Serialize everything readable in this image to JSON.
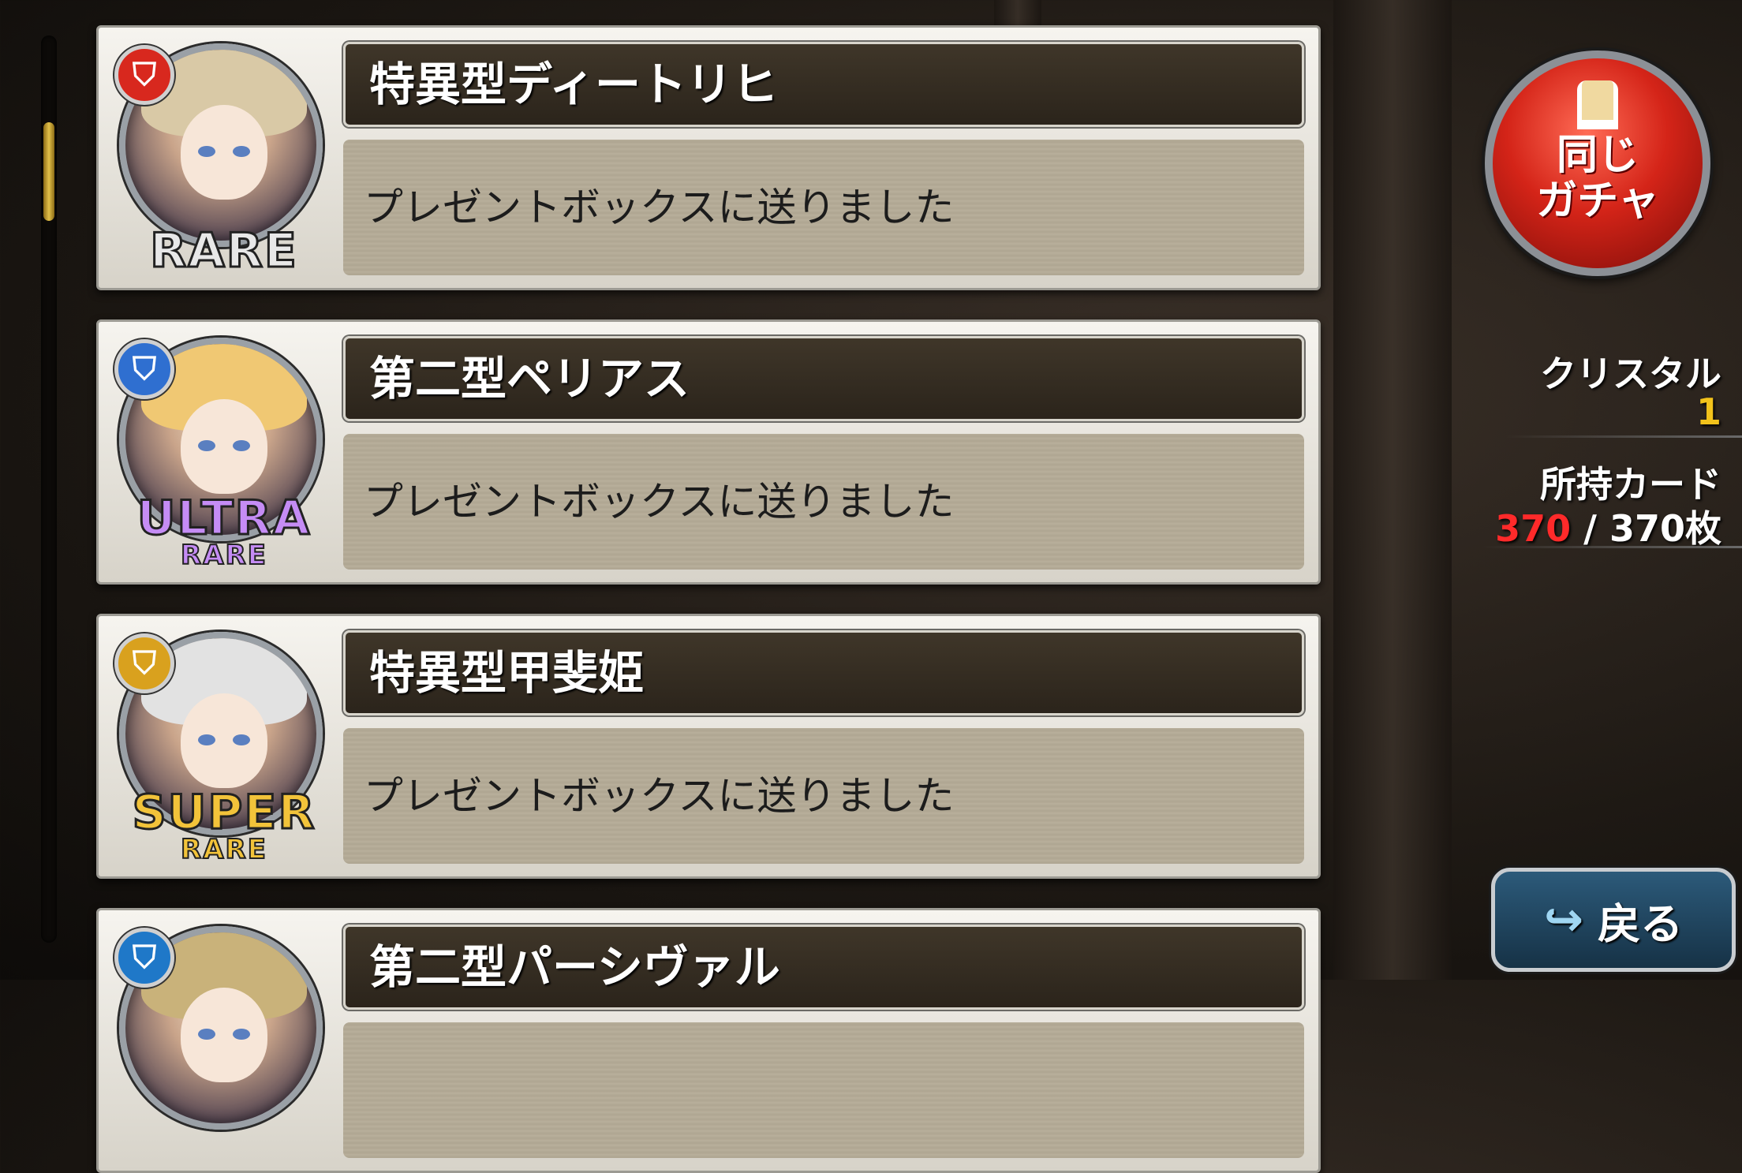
{
  "results": [
    {
      "name": "特異型ディートリヒ",
      "message": "プレゼントボックスに送りました",
      "rarity_main": "RARE",
      "rarity_sub": "",
      "badge_color": "#d8281e",
      "rarity_color": "#e8e8e8",
      "hair_color": "#d9c9a6"
    },
    {
      "name": "第二型ペリアス",
      "message": "プレゼントボックスに送りました",
      "rarity_main": "ULTRA",
      "rarity_sub": "RARE",
      "badge_color": "#2f6fd0",
      "rarity_color": "#c58cf5",
      "hair_color": "#f0c873"
    },
    {
      "name": "特異型甲斐姫",
      "message": "プレゼントボックスに送りました",
      "rarity_main": "SUPER",
      "rarity_sub": "RARE",
      "badge_color": "#d9a11e",
      "rarity_color": "#f2c33a",
      "hair_color": "#e2e2e2"
    },
    {
      "name": "第二型パーシヴァル",
      "message": "",
      "rarity_main": "",
      "rarity_sub": "",
      "badge_color": "#1f78c8",
      "rarity_color": "#cccccc",
      "hair_color": "#c9b27a"
    }
  ],
  "gacha_button": {
    "label": "同じ\nガチャ"
  },
  "crystal": {
    "label": "クリスタル",
    "value": "1"
  },
  "owned_cards": {
    "label": "所持カード",
    "current": "370",
    "separator": " / ",
    "max": "370枚"
  },
  "back_button": {
    "label": "戻る"
  }
}
